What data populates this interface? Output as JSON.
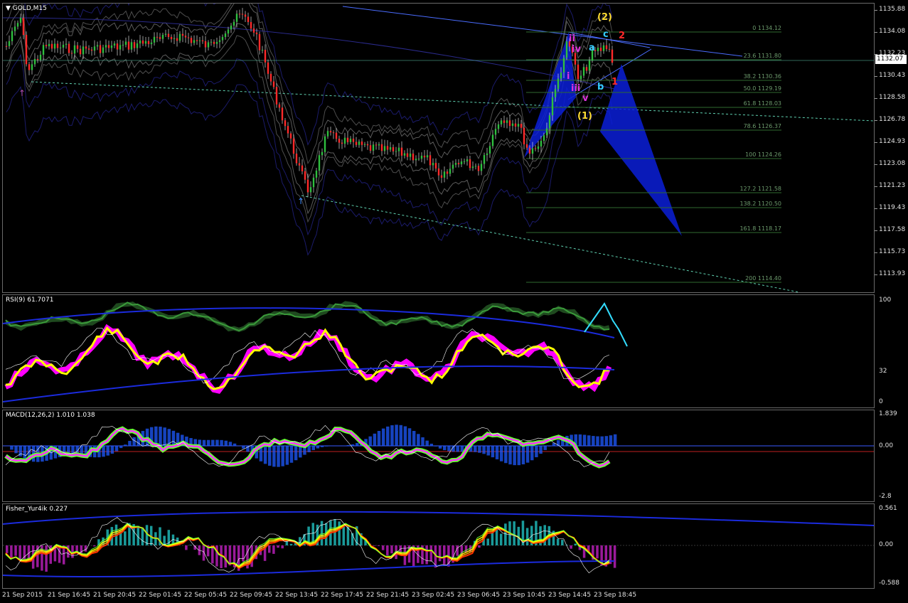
{
  "main_pane": {
    "title": "GOLD,M15",
    "current_price": "1132.07",
    "price_scale": [
      "1135.88",
      "1134.08",
      "1132.23",
      "1130.43",
      "1128.58",
      "1126.78",
      "1124.93",
      "1123.08",
      "1121.23",
      "1119.43",
      "1117.58",
      "1115.73",
      "1113.93"
    ],
    "fib_levels": [
      "0 1134.12",
      "23.6 1131.80",
      "38.2 1130.36",
      "50.0 1129.19",
      "61.8 1128.03",
      "78.6 1126.37",
      "100 1124.26",
      "127.2 1121.58",
      "138.2 1120.50",
      "161.8 1118.17",
      "200 1114.40"
    ],
    "wave_labels": {
      "w2": "(2)",
      "w1": "(1)",
      "c": "c",
      "a": "a",
      "b": "b",
      "red2": "2",
      "red1": "1",
      "ii": "ii",
      "iv": "iv",
      "i": "i",
      "iii": "iii",
      "v": "v"
    }
  },
  "rsi_pane": {
    "title": "RSI(9) 61.7071",
    "scale": [
      "100",
      "32",
      "0"
    ]
  },
  "macd_pane": {
    "title": "MACD(12,26,2) 1.010 1.038",
    "scale": [
      "1.839",
      "0.00",
      "-2.8"
    ]
  },
  "fisher_pane": {
    "title": "Fisher_Yur4ik 0.227",
    "scale": [
      "0.561",
      "0.00",
      "-0.588"
    ]
  },
  "time_axis": [
    "21 Sep 2015",
    "21 Sep 16:45",
    "21 Sep 20:45",
    "22 Sep 01:45",
    "22 Sep 05:45",
    "22 Sep 09:45",
    "22 Sep 13:45",
    "22 Sep 17:45",
    "22 Sep 21:45",
    "23 Sep 02:45",
    "23 Sep 06:45",
    "23 Sep 10:45",
    "23 Sep 14:45",
    "23 Sep 18:45"
  ],
  "colors": {
    "bull_candle": "#2fbf3f",
    "bear_candle": "#ff2a2a",
    "rsi_line": "#ffff00",
    "rsi_dots": "#ff00ff",
    "macd_hist": "#1e5aff",
    "fisher_pos": "#1a9a9a",
    "fisher_neg": "#9a1a9a",
    "fib": "#3a7a3a",
    "pattern": "#0a1fd8",
    "wave_yellow": "#ffdd33",
    "wave_cyan": "#33ccff",
    "wave_red": "#ff2a2a",
    "wave_magenta": "#dd33dd"
  }
}
